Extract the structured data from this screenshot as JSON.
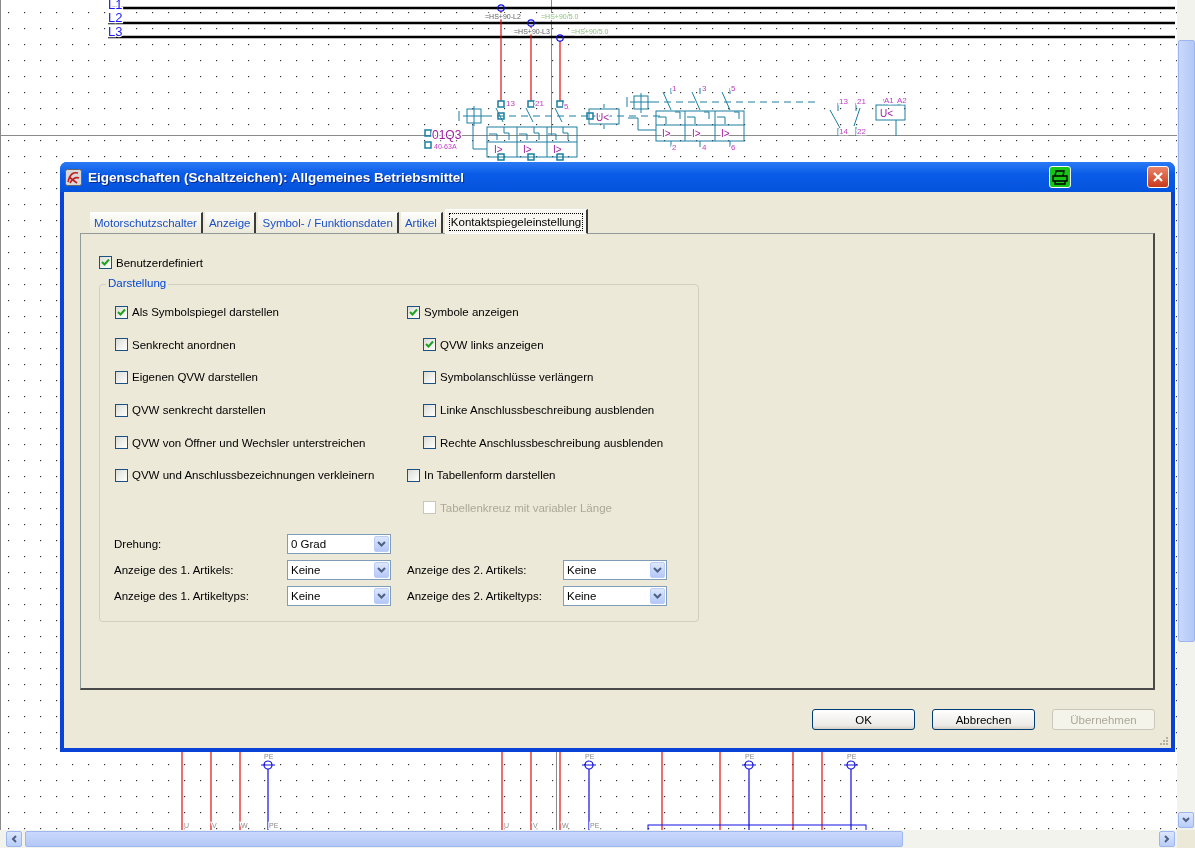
{
  "schematic": {
    "labels": [
      {
        "text": "L1",
        "kind": "bus"
      },
      {
        "text": "L2",
        "kind": "bus"
      },
      {
        "text": "L3",
        "kind": "bus"
      },
      {
        "text": "=HS+90-L2",
        "kind": "reference"
      },
      {
        "text": "=HS+90/5.0",
        "kind": "page"
      },
      {
        "text": "=HS+90-L3",
        "kind": "reference"
      },
      {
        "text": "=HS+90/5.0",
        "kind": "page"
      },
      {
        "text": "13",
        "kind": "pin"
      },
      {
        "text": "21",
        "kind": "pin"
      },
      {
        "text": "5",
        "kind": "pin"
      },
      {
        "text": "01Q3",
        "kind": "tag"
      },
      {
        "text": "40-63A",
        "kind": "rating"
      },
      {
        "text": "I>",
        "kind": "symbol"
      },
      {
        "text": "I>",
        "kind": "symbol"
      },
      {
        "text": "I>",
        "kind": "symbol"
      },
      {
        "text": "U<",
        "kind": "symbol"
      },
      {
        "text": "1",
        "kind": "pin"
      },
      {
        "text": "3",
        "kind": "pin"
      },
      {
        "text": "5",
        "kind": "pin"
      },
      {
        "text": "I>",
        "kind": "symbol"
      },
      {
        "text": "I>",
        "kind": "symbol"
      },
      {
        "text": "I>",
        "kind": "symbol"
      },
      {
        "text": "2",
        "kind": "pin"
      },
      {
        "text": "4",
        "kind": "pin"
      },
      {
        "text": "6",
        "kind": "pin"
      },
      {
        "text": "13",
        "kind": "pin"
      },
      {
        "text": "21",
        "kind": "pin"
      },
      {
        "text": "14",
        "kind": "pin"
      },
      {
        "text": "22",
        "kind": "pin"
      },
      {
        "text": "A1",
        "kind": "pin"
      },
      {
        "text": "A2",
        "kind": "pin"
      },
      {
        "text": "U<",
        "kind": "symbol"
      },
      {
        "text": "PE",
        "kind": "terminal"
      },
      {
        "text": "PE",
        "kind": "terminal"
      },
      {
        "text": "PE",
        "kind": "terminal"
      },
      {
        "text": "PE",
        "kind": "terminal"
      },
      {
        "text": "U",
        "kind": "terminal"
      },
      {
        "text": "V",
        "kind": "terminal"
      },
      {
        "text": "W",
        "kind": "terminal"
      },
      {
        "text": "PE",
        "kind": "terminal"
      },
      {
        "text": "U",
        "kind": "terminal"
      },
      {
        "text": "V",
        "kind": "terminal"
      },
      {
        "text": "W",
        "kind": "terminal"
      },
      {
        "text": "PE",
        "kind": "terminal"
      }
    ]
  },
  "dialog": {
    "title": "Eigenschaften (Schaltzeichen): Allgemeines Betriebsmittel",
    "tabs": [
      {
        "label": "Motorschutzschalter",
        "selected": false
      },
      {
        "label": "Anzeige",
        "selected": false
      },
      {
        "label": "Symbol- / Funktionsdaten",
        "selected": false
      },
      {
        "label": "Artikel",
        "selected": false
      },
      {
        "label": "Kontaktspiegeleinstellung",
        "selected": true
      }
    ],
    "custom": {
      "label": "Benutzerdefiniert",
      "checked": true
    },
    "group": {
      "title": "Darstellung",
      "left_options": [
        {
          "label": "Als Symbolspiegel darstellen",
          "checked": true,
          "disabled": false
        },
        {
          "label": "Senkrecht anordnen",
          "checked": false,
          "disabled": false
        },
        {
          "label": "Eigenen QVW darstellen",
          "checked": false,
          "disabled": false
        },
        {
          "label": "QVW senkrecht darstellen",
          "checked": false,
          "disabled": false
        },
        {
          "label": "QVW von Öffner und Wechsler unterstreichen",
          "checked": false,
          "disabled": false
        },
        {
          "label": "QVW und Anschlussbezeichnungen verkleinern",
          "checked": false,
          "disabled": false
        }
      ],
      "right_options": [
        {
          "label": "Symbole anzeigen",
          "checked": true,
          "disabled": false,
          "children": [
            {
              "label": "QVW links anzeigen",
              "checked": true,
              "disabled": false
            },
            {
              "label": "Symbolanschlüsse verlängern",
              "checked": false,
              "disabled": false
            },
            {
              "label": "Linke Anschlussbeschreibung ausblenden",
              "checked": false,
              "disabled": false
            },
            {
              "label": "Rechte Anschlussbeschreibung ausblenden",
              "checked": false,
              "disabled": false
            }
          ]
        },
        {
          "label": "In Tabellenform darstellen",
          "checked": false,
          "disabled": false,
          "children": [
            {
              "label": "Tabellenkreuz mit variabler Länge",
              "checked": false,
              "disabled": true
            }
          ]
        }
      ],
      "field_rows": [
        [
          {
            "label": "Drehung:",
            "value": "0 Grad"
          }
        ],
        [
          {
            "label": "Anzeige des 1. Artikels:",
            "value": "Keine"
          },
          {
            "label": "Anzeige des 2. Artikels:",
            "value": "Keine"
          }
        ],
        [
          {
            "label": "Anzeige des 1. Artikeltyps:",
            "value": "Keine"
          },
          {
            "label": "Anzeige des 2. Artikeltyps:",
            "value": "Keine"
          }
        ]
      ]
    },
    "buttons": [
      {
        "label": "OK",
        "disabled": false
      },
      {
        "label": "Abbrechen",
        "disabled": false
      },
      {
        "label": "Übernehmen",
        "disabled": true
      }
    ]
  }
}
